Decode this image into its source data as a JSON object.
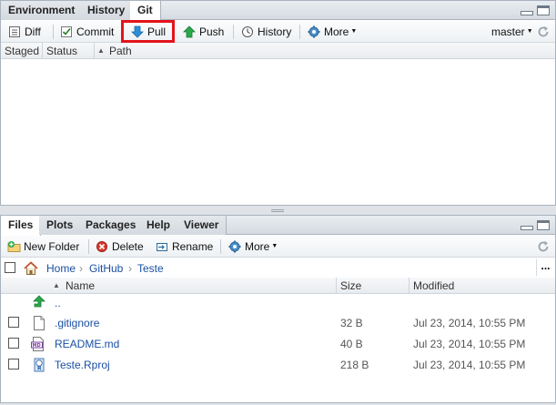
{
  "top_pane": {
    "tabs": [
      "Environment",
      "History",
      "Git"
    ],
    "active_tab": "Git",
    "toolbar": {
      "diff": "Diff",
      "commit": "Commit",
      "pull": "Pull",
      "push": "Push",
      "history": "History",
      "more": "More",
      "branch": "master"
    },
    "columns": {
      "staged": "Staged",
      "status": "Status",
      "path": "Path"
    }
  },
  "bottom_pane": {
    "tabs": [
      "Files",
      "Plots",
      "Packages",
      "Help",
      "Viewer"
    ],
    "active_tab": "Files",
    "toolbar": {
      "new_folder": "New Folder",
      "delete": "Delete",
      "rename": "Rename",
      "more": "More"
    },
    "breadcrumb": [
      "Home",
      "GitHub",
      "Teste"
    ],
    "more_glyph": "...",
    "columns": {
      "name": "Name",
      "size": "Size",
      "modified": "Modified"
    },
    "parent_dir": "..",
    "files": [
      {
        "name": ".gitignore",
        "size": "32 B",
        "modified": "Jul 23, 2014, 10:55 PM",
        "icon": "text-file-icon"
      },
      {
        "name": "README.md",
        "size": "40 B",
        "modified": "Jul 23, 2014, 10:55 PM",
        "icon": "markdown-file-icon"
      },
      {
        "name": "Teste.Rproj",
        "size": "218 B",
        "modified": "Jul 23, 2014, 10:55 PM",
        "icon": "rproj-file-icon"
      }
    ]
  },
  "colors": {
    "highlight": "#e3141b",
    "link": "#1a4fa3",
    "pull_arrow": "#2d8fd6",
    "push_arrow": "#2aa84a"
  }
}
